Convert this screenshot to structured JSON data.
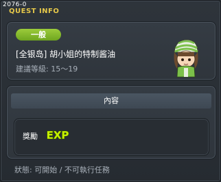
{
  "window": {
    "quest_id": "2076-0",
    "title": "QUEST INFO"
  },
  "quest": {
    "level_badge": "一般",
    "name": "[全银岛] 胡小姐的特制酱油",
    "recommended_level": "建議等級: 15～19",
    "npc_icon": "npc-portrait"
  },
  "content": {
    "header": "內容",
    "reward_label": "獎勵",
    "reward_icon": "exp-icon",
    "reward_icon_text": "EXP"
  },
  "status": "狀態: 可開始 / 不可執行任務",
  "colors": {
    "title": "#e6c84a",
    "badge": "#86ba2c",
    "exp": "#c6f000"
  }
}
